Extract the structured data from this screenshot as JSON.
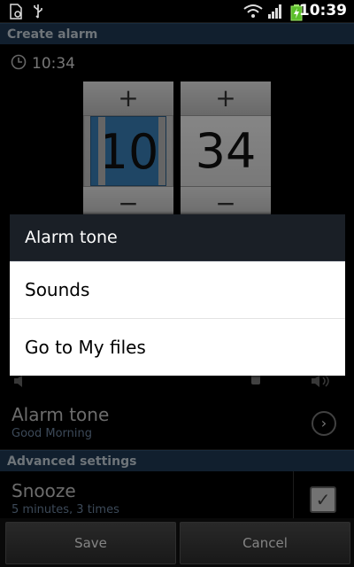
{
  "status_bar": {
    "time": "10:39"
  },
  "header": {
    "title": "Create alarm"
  },
  "clock": {
    "time_text": "10:34"
  },
  "time_picker": {
    "hour": "10",
    "minute": "34",
    "plus": "+",
    "minus": "−"
  },
  "dialog": {
    "title": "Alarm tone",
    "items": [
      {
        "label": "Sounds"
      },
      {
        "label": "Go to My files"
      }
    ]
  },
  "settings": {
    "alarm_tone": {
      "title": "Alarm tone",
      "value": "Good Morning"
    },
    "advanced_header": "Advanced settings",
    "snooze": {
      "title": "Snooze",
      "value": "5 minutes, 3 times",
      "checked": true
    }
  },
  "buttons": {
    "save": "Save",
    "cancel": "Cancel"
  }
}
